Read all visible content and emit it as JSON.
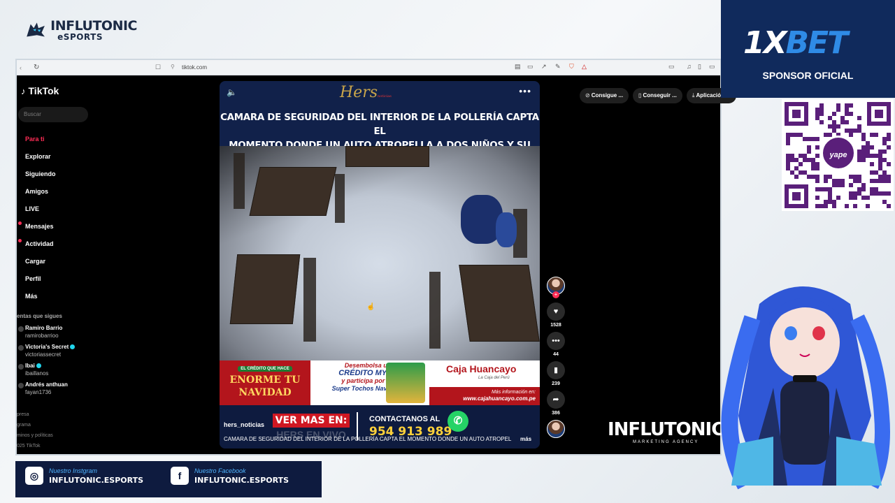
{
  "overlay": {
    "brand_line1": "INFLUTONIC",
    "brand_line2": "eSPORTS",
    "sponsor_logo_a": "1X",
    "sponsor_logo_b": "BET",
    "sponsor_label": "SPONSOR OFICIAL",
    "yape_label": "yape",
    "watermark_line1": "INFLUTONIC",
    "watermark_line2": "MARKETING AGENCY",
    "instagram_caption": "Nuestro Instgram",
    "instagram_handle": "INFLUTONIC.ESPORTS",
    "facebook_caption": "Nuestro Facebook",
    "facebook_handle": "INFLUTONIC.ESPORTS"
  },
  "browser": {
    "url": "tiktok.com",
    "nav_back_icon": "chevron-left-icon",
    "reload_icon": "reload-icon"
  },
  "tiktok": {
    "logo": "TikTok",
    "search_placeholder": "Buscar",
    "nav": [
      {
        "label": "Para ti",
        "active": true
      },
      {
        "label": "Explorar"
      },
      {
        "label": "Siguiendo"
      },
      {
        "label": "Amigos"
      },
      {
        "label": "LIVE"
      },
      {
        "label": "Mensajes",
        "badge": true
      },
      {
        "label": "Actividad",
        "badge": true
      },
      {
        "label": "Cargar"
      },
      {
        "label": "Perfil"
      },
      {
        "label": "Más"
      }
    ],
    "following_title": "entas que sigues",
    "following": [
      {
        "name": "Ramiro  Barrio",
        "user": "ramirobarrioo",
        "verified": false
      },
      {
        "name": "Victoria's Secret",
        "user": "victoriassecret",
        "verified": true
      },
      {
        "name": "Ibai",
        "user": "ibaillanos",
        "verified": true
      },
      {
        "name": "Andrés anthuan",
        "user": "fayan1736",
        "verified": false
      }
    ],
    "footer": [
      "presa",
      "grama",
      "minos y políticas",
      "025 TikTok"
    ],
    "top_tabs": [
      {
        "icon": "⊘",
        "label": "Consigue ..."
      },
      {
        "icon": "▯",
        "label": "Conseguir ..."
      },
      {
        "icon": "⤓",
        "label": "Aplicación ..."
      }
    ]
  },
  "video": {
    "hers_logo": "Hers",
    "hers_sub": "noticias",
    "headline_1": "CAMARA DE SEGURIDAD DEL INTERIOR DE LA POLLERÍA CAPTA EL",
    "headline_2": "MOMENTO DONDE UN AUTO ATROPELLA A DOS NIÑOS Y SU MAMÁ",
    "ad_badge": "EL CRÉDITO QUE HACE",
    "ad_title_1": "ENORME TU",
    "ad_title_2": "NAVIDAD",
    "ad_mid_1": "Desembolsa un",
    "ad_mid_2": "CRÉDITO MYPE",
    "ad_mid_3": "y participa por un",
    "ad_mid_4": "Super Tochos Navideño",
    "ad_brand": "Caja Huancayo",
    "ad_brand_sub": "La Caja del Perú",
    "ad_info_1": "Más información en:",
    "ad_info_2": "www.cajahuancayo.com.pe",
    "author": "hers_noticias",
    "cta": "VER MAS EN:",
    "cta_ghost": "HERS EN VIVO",
    "contact": "CONTACTANOS AL",
    "phone": "954 913 989",
    "description": "CAMARA DE SEGURIDAD DEL INTERIOR DE LA POLLERÍA CAPTA EL MOMENTO DONDE UN AUTO ATROPELLA A",
    "more": "más",
    "likes": "1528",
    "comments": "44",
    "saves": "239",
    "shares": "386"
  }
}
